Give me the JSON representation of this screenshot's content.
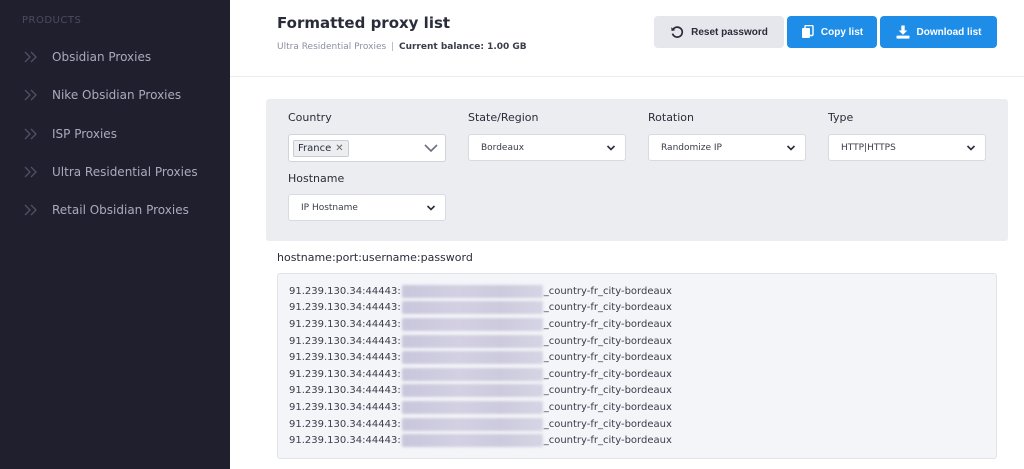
{
  "sidebar": {
    "section_label": "PRODUCTS",
    "items": [
      {
        "label": "Obsidian Proxies"
      },
      {
        "label": "Nike Obsidian Proxies"
      },
      {
        "label": "ISP Proxies"
      },
      {
        "label": "Ultra Residential Proxies"
      },
      {
        "label": "Retail Obsidian Proxies"
      }
    ]
  },
  "header": {
    "title": "Formatted proxy list",
    "product_name": "Ultra Residential Proxies",
    "separator": "|",
    "balance": "Current balance: 1.00 GB"
  },
  "toolbar": {
    "reset_label": "Reset password",
    "copy_label": "Copy list",
    "download_label": "Download list"
  },
  "filters": {
    "country": {
      "label": "Country",
      "selected": "France",
      "remove_glyph": "✕"
    },
    "state": {
      "label": "State/Region",
      "selected": "Bordeaux"
    },
    "rotation": {
      "label": "Rotation",
      "selected": "Randomize IP"
    },
    "type": {
      "label": "Type",
      "selected": "HTTP|HTTPS"
    },
    "hostname": {
      "label": "Hostname",
      "selected": "IP Hostname"
    }
  },
  "output": {
    "format_label": "hostname:port:username:password",
    "lines": [
      {
        "prefix": "91.239.130.34:44443:",
        "suffix": "_country-fr_city-bordeaux"
      },
      {
        "prefix": "91.239.130.34:44443:",
        "suffix": "_country-fr_city-bordeaux"
      },
      {
        "prefix": "91.239.130.34:44443:",
        "suffix": "_country-fr_city-bordeaux"
      },
      {
        "prefix": "91.239.130.34:44443:",
        "suffix": "_country-fr_city-bordeaux"
      },
      {
        "prefix": "91.239.130.34:44443:",
        "suffix": "_country-fr_city-bordeaux"
      },
      {
        "prefix": "91.239.130.34:44443:",
        "suffix": "_country-fr_city-bordeaux"
      },
      {
        "prefix": "91.239.130.34:44443:",
        "suffix": "_country-fr_city-bordeaux"
      },
      {
        "prefix": "91.239.130.34:44443:",
        "suffix": "_country-fr_city-bordeaux"
      },
      {
        "prefix": "91.239.130.34:44443:",
        "suffix": "_country-fr_city-bordeaux"
      },
      {
        "prefix": "91.239.130.34:44443:",
        "suffix": "_country-fr_city-bordeaux"
      }
    ]
  },
  "icons": {
    "sidebar_item": "chevron-double-right-icon",
    "reset": "undo-icon",
    "copy": "copy-icon",
    "download": "download-icon",
    "select": "chevron-down-icon"
  },
  "colors": {
    "sidebar_bg": "#1f1f2e",
    "accent": "#1e8de8",
    "panel_bg": "#ecedf1"
  }
}
